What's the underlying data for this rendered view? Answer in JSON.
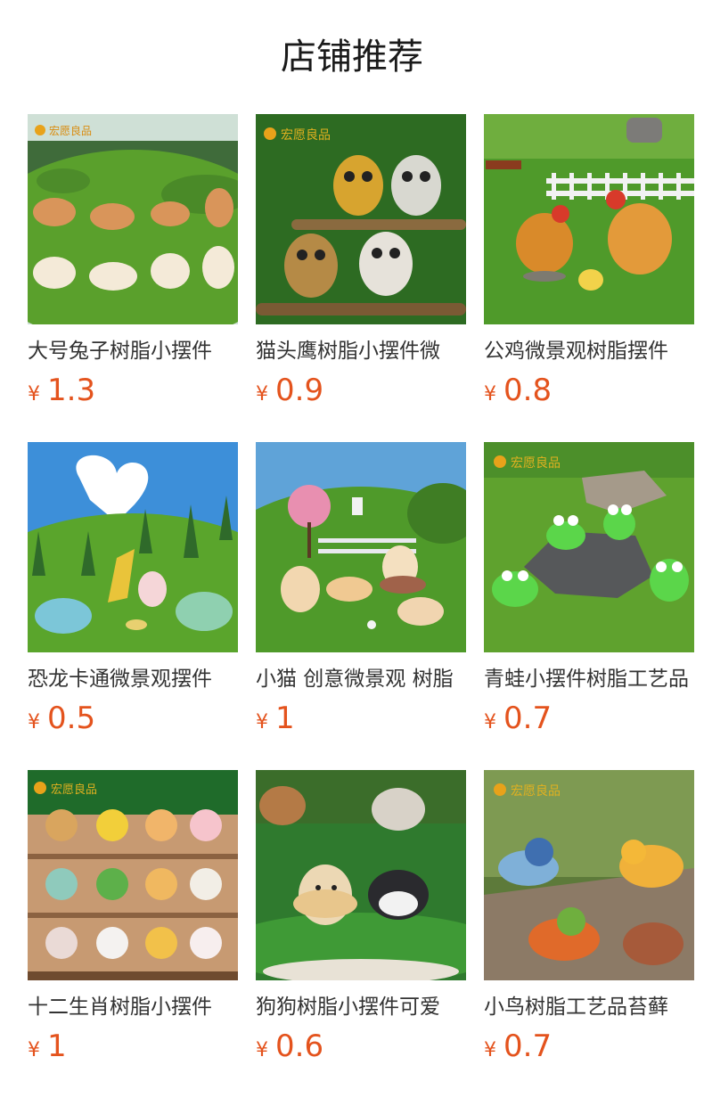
{
  "page": {
    "title": "店铺推荐"
  },
  "colors": {
    "price": "#e4531d",
    "title": "#1a1a1a",
    "name": "#333333"
  },
  "products": [
    {
      "name": "大号兔子树脂小摆件",
      "currency": "¥",
      "price": "1.3",
      "image": "rabbits-on-grass"
    },
    {
      "name": "猫头鹰树脂小摆件微",
      "currency": "¥",
      "price": "0.9",
      "image": "owls-on-branch"
    },
    {
      "name": "公鸡微景观树脂摆件",
      "currency": "¥",
      "price": "0.8",
      "image": "roosters-by-fence"
    },
    {
      "name": "恐龙卡通微景观摆件",
      "currency": "¥",
      "price": "0.5",
      "image": "cartoon-dinosaurs"
    },
    {
      "name": "小猫 创意微景观 树脂",
      "currency": "¥",
      "price": "1",
      "image": "kittens-on-lawn"
    },
    {
      "name": "青蛙小摆件树脂工艺品",
      "currency": "¥",
      "price": "0.7",
      "image": "frogs-on-rock"
    },
    {
      "name": "十二生肖树脂小摆件",
      "currency": "¥",
      "price": "1",
      "image": "zodiac-figurines"
    },
    {
      "name": "狗狗树脂小摆件可爱",
      "currency": "¥",
      "price": "0.6",
      "image": "puppies-on-grass"
    },
    {
      "name": "小鸟树脂工艺品苔藓",
      "currency": "¥",
      "price": "0.7",
      "image": "birds-on-stump"
    }
  ]
}
